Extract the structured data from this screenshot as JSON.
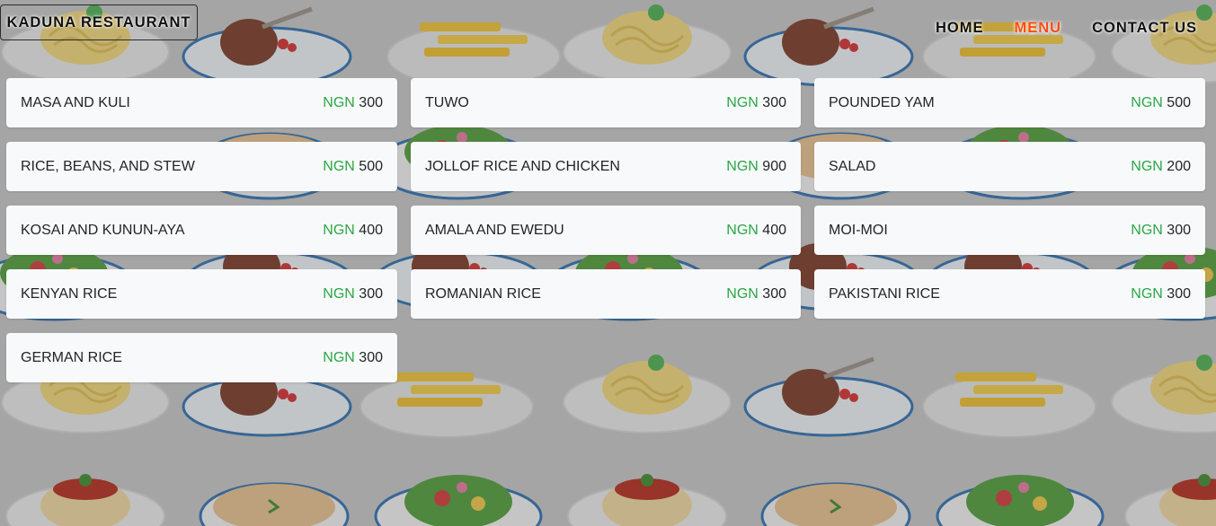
{
  "header": {
    "brand": "KADUNA RESTAURANT",
    "nav": [
      {
        "label": "HOME",
        "active": false
      },
      {
        "label": "MENU",
        "active": true
      },
      {
        "label": "CONTACT US",
        "active": false
      }
    ]
  },
  "menu": {
    "items": [
      {
        "name": "MASA AND KULI",
        "currency": "NGN",
        "price": "300"
      },
      {
        "name": "TUWO",
        "currency": "NGN",
        "price": "300"
      },
      {
        "name": "POUNDED YAM",
        "currency": "NGN",
        "price": "500"
      },
      {
        "name": "RICE, BEANS, AND STEW",
        "currency": "NGN",
        "price": "500"
      },
      {
        "name": "JOLLOF RICE AND CHICKEN",
        "currency": "NGN",
        "price": "900"
      },
      {
        "name": "SALAD",
        "currency": "NGN",
        "price": "200"
      },
      {
        "name": "KOSAI AND KUNUN-AYA",
        "currency": "NGN",
        "price": "400"
      },
      {
        "name": "AMALA AND EWEDU",
        "currency": "NGN",
        "price": "400"
      },
      {
        "name": "MOI-MOI",
        "currency": "NGN",
        "price": "300"
      },
      {
        "name": "KENYAN RICE",
        "currency": "NGN",
        "price": "300"
      },
      {
        "name": "ROMANIAN RICE",
        "currency": "NGN",
        "price": "300"
      },
      {
        "name": "PAKISTANI RICE",
        "currency": "NGN",
        "price": "300"
      },
      {
        "name": "GERMAN RICE",
        "currency": "NGN",
        "price": "300"
      }
    ]
  },
  "colors": {
    "accent_nav": "#ff4b12",
    "currency": "#28a745",
    "card_background": "#f8f9fa"
  },
  "background": {
    "pattern_icons": [
      "spaghetti-plate-icon",
      "steak-plate-icon",
      "fries-plate-icon",
      "soup-bowl-icon",
      "salad-plate-icon",
      "pasta-sauce-plate-icon"
    ]
  }
}
